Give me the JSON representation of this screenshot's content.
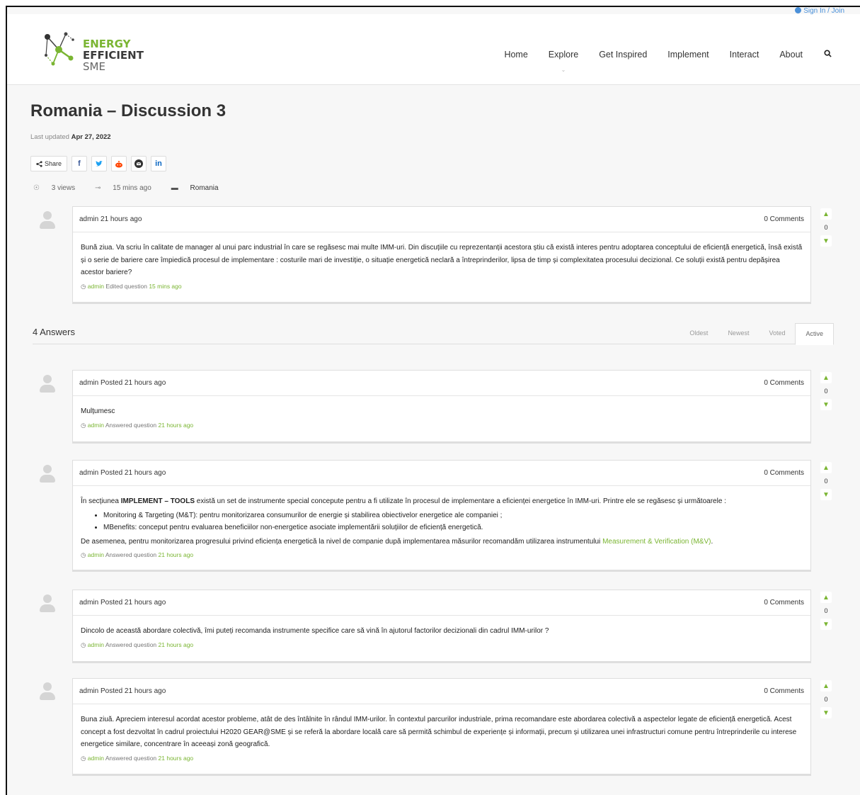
{
  "header": {
    "signin": "Sign In / Join",
    "logo": {
      "line1": "ENERGY",
      "line2": "EFFICIENT",
      "line3": "SME"
    },
    "nav": [
      "Home",
      "Explore",
      "Get Inspired",
      "Implement",
      "Interact",
      "About"
    ]
  },
  "page": {
    "title": "Romania – Discussion 3",
    "updated_label": "Last updated",
    "updated_date": "Apr 27, 2022",
    "share_label": "Share",
    "views": "3 views",
    "activity": "15 mins ago",
    "category": "Romania"
  },
  "question": {
    "author_time": "admin 21 hours ago",
    "comments": "0 Comments",
    "votes": "0",
    "body": "Bună ziua. Va scriu în calitate de manager al unui parc industrial în care se regăsesc mai multe IMM-uri. Din discuțiile cu reprezentanții acestora știu că există interes pentru adoptarea conceptului de eficiență energetică, însă există și o serie de bariere care împiedică procesul de implementare : costurile mari de investiție, o situație energetică neclară a întreprinderilor, lipsa de timp și complexitatea procesului decizional. Ce soluții există pentru depășirea acestor bariere?",
    "foot_user": "admin",
    "foot_action": "Edited question",
    "foot_time": "15 mins ago"
  },
  "answers_header": {
    "count": "4 Answers",
    "tabs": [
      "Oldest",
      "Newest",
      "Voted",
      "Active"
    ]
  },
  "answers": [
    {
      "author_time": "admin Posted 21 hours ago",
      "comments": "0 Comments",
      "votes": "0",
      "body": "Mulțumesc",
      "foot_user": "admin",
      "foot_action": "Answered question",
      "foot_time": "21 hours ago"
    },
    {
      "author_time": "admin Posted 21 hours ago",
      "comments": "0 Comments",
      "votes": "0",
      "body_pre": "În secțiunea ",
      "body_bold": "IMPLEMENT – TOOLS",
      "body_post": " există un set de instrumente special concepute pentru a fi utilizate în procesul de implementare a eficienței energetice în IMM-uri. Printre ele se regăsesc și următoarele :",
      "bullets": [
        "Monitoring & Targeting (M&T): pentru monitorizarea consumurilor de energie și stabilirea obiectivelor energetice ale companiei ;",
        "MBenefits: conceput pentru evaluarea beneficiilor non-energetice asociate implementării soluțiilor de eficiență energetică."
      ],
      "body2_pre": "De asemenea, pentru monitorizarea progresului privind eficiența energetică la nivel de companie după implementarea măsurilor recomandăm utilizarea instrumentului ",
      "body2_link": "Measurement & Verification (M&V)",
      "body2_post": ".",
      "foot_user": "admin",
      "foot_action": "Answered question",
      "foot_time": "21 hours ago"
    },
    {
      "author_time": "admin Posted 21 hours ago",
      "comments": "0 Comments",
      "votes": "0",
      "body": "Dincolo de această abordare colectivă, îmi puteți recomanda instrumente specifice care să vină în ajutorul factorilor decizionali din cadrul IMM-urilor ?",
      "foot_user": "admin",
      "foot_action": "Answered question",
      "foot_time": "21 hours ago"
    },
    {
      "author_time": "admin Posted 21 hours ago",
      "comments": "0 Comments",
      "votes": "0",
      "body": "Buna ziuă. Apreciem interesul acordat acestor probleme, atât de des întâlnite în rândul IMM-urilor. În contextul parcurilor industriale, prima recomandare este abordarea colectivă a aspectelor legate de eficiență energetică. Acest concept a fost dezvoltat în cadrul proiectului H2020 GEAR@SME și se referă la abordare locală care să permită schimbul de experiențe și informații, precum și utilizarea unei infrastructuri comune pentru întreprinderile cu interese energetice similare, concentrare în aceeași zonă geografică.",
      "foot_user": "admin",
      "foot_action": "Answered question",
      "foot_time": "21 hours ago"
    }
  ],
  "colors": {
    "accent": "#7ab532",
    "link": "#4a90d9"
  }
}
